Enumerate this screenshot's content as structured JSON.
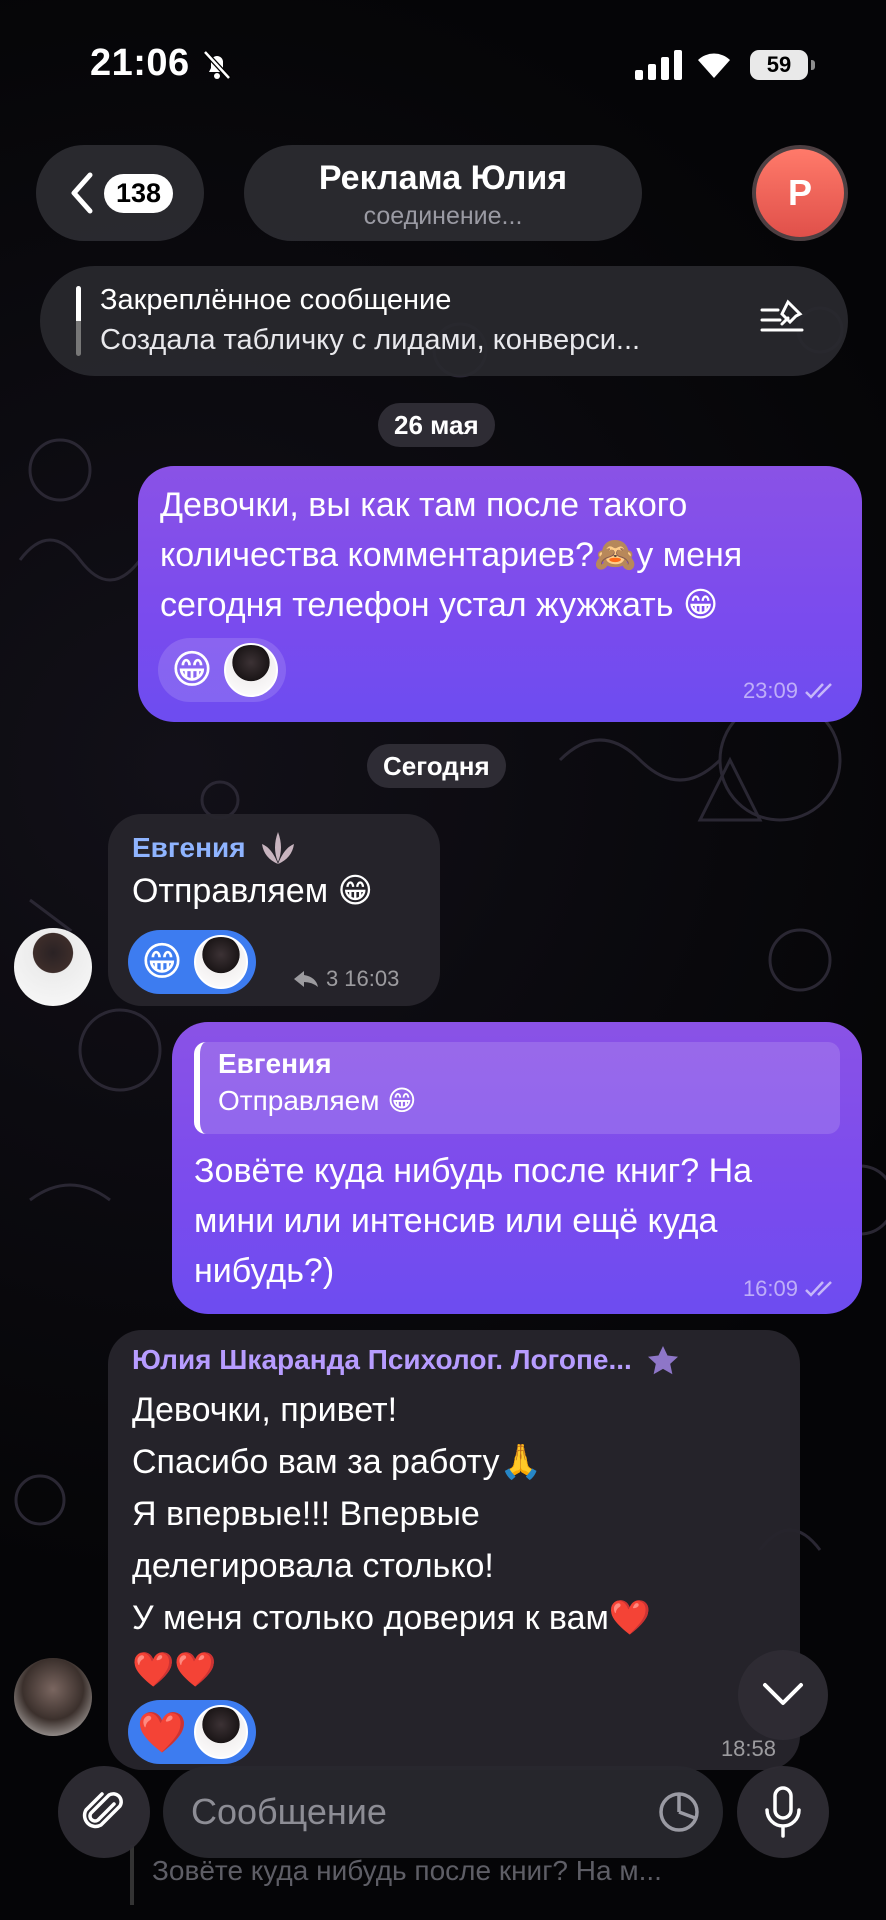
{
  "status_bar": {
    "time": "21:06",
    "battery": "59"
  },
  "header": {
    "back_count": "138",
    "chat_title": "Реклама Юлия",
    "chat_status": "соединение...",
    "avatar_letter": "Р"
  },
  "pinned": {
    "title": "Закреплённое сообщение",
    "text": "Создала табличку с лидами, конверси..."
  },
  "dates": {
    "first": "26 мая",
    "second": "Сегодня"
  },
  "messages": [
    {
      "lines": [
        "Девочки, вы как там после такого",
        "количества комментариев?🙈у меня",
        "сегодня телефон устал жужжать 😁"
      ],
      "reaction": "😁",
      "time": "23:09"
    },
    {
      "sender": "Евгения",
      "text": "Отправляем 😁",
      "reaction": "😁",
      "replies": "3",
      "time": "16:03"
    },
    {
      "quote_sender": "Евгения",
      "quote_text": "Отправляем 😁",
      "lines": [
        "Зовёте куда нибудь после книг? На",
        "мини или интенсив или ещё куда",
        "нибудь?)"
      ],
      "time": "16:09"
    },
    {
      "sender": "Юлия Шкаранда Психолог. Логопе...",
      "lines": [
        "Девочки, привет!",
        "Спасибо вам за работу🙏",
        "Я впервые!!! Впервые",
        "делегировала столько!",
        "У меня столько доверия к вам❤️",
        "❤️❤️"
      ],
      "reaction": "❤️",
      "time": "18:58"
    }
  ],
  "composer": {
    "placeholder": "Сообщение",
    "reply_preview": "Зовёте куда нибудь после книг? На м..."
  },
  "colors": {
    "outgoing": "#7a4bee",
    "incoming": "#26242c",
    "sender_name": "#8fb4ff",
    "accent_name": "#b79cff"
  }
}
